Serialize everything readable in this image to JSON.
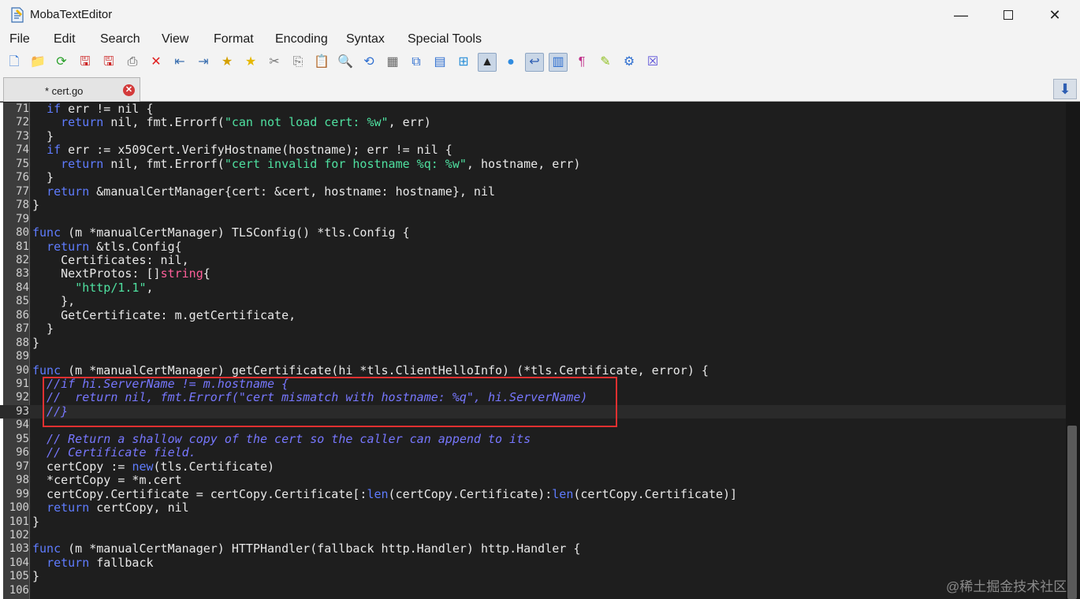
{
  "window": {
    "title": "MobaTextEditor"
  },
  "menu": [
    "File",
    "Edit",
    "Search",
    "View",
    "Format",
    "Encoding",
    "Syntax",
    "Special Tools"
  ],
  "toolbar": [
    {
      "name": "new-file-icon",
      "glyph": "🗋",
      "color": "#3a7bd5"
    },
    {
      "name": "open-folder-icon",
      "glyph": "📁",
      "color": "#e0a800"
    },
    {
      "name": "reload-icon",
      "glyph": "⟳",
      "color": "#2aa12a"
    },
    {
      "name": "save-icon",
      "glyph": "🖫",
      "color": "#cc2222"
    },
    {
      "name": "save-all-icon",
      "glyph": "🖫",
      "color": "#cc2222"
    },
    {
      "name": "print-icon",
      "glyph": "⎙",
      "color": "#555555"
    },
    {
      "name": "delete-icon",
      "glyph": "✕",
      "color": "#e02020"
    },
    {
      "name": "outdent-icon",
      "glyph": "⇤",
      "color": "#3a6fb0"
    },
    {
      "name": "indent-icon",
      "glyph": "⇥",
      "color": "#3a6fb0"
    },
    {
      "name": "bookmark-star-icon",
      "glyph": "★",
      "color": "#d4a000"
    },
    {
      "name": "bookmark-next-icon",
      "glyph": "★",
      "color": "#e6b800"
    },
    {
      "name": "cut-icon",
      "glyph": "✂",
      "color": "#777777"
    },
    {
      "name": "copy-icon",
      "glyph": "⎘",
      "color": "#777777"
    },
    {
      "name": "paste-icon",
      "glyph": "📋",
      "color": "#4a6fa5"
    },
    {
      "name": "find-icon",
      "glyph": "🔍",
      "color": "#2f6fd0"
    },
    {
      "name": "replace-icon",
      "glyph": "⟲",
      "color": "#2f6fd0"
    },
    {
      "name": "macro-icon",
      "glyph": "▦",
      "color": "#666666"
    },
    {
      "name": "compare-icon",
      "glyph": "⧉",
      "color": "#2f6fd0"
    },
    {
      "name": "split-view-icon",
      "glyph": "▤",
      "color": "#2f6fd0"
    },
    {
      "name": "windows-eol-icon",
      "glyph": "⊞",
      "color": "#2a8fd8"
    },
    {
      "name": "linux-eol-icon",
      "glyph": "▲",
      "color": "#222222"
    },
    {
      "name": "mac-eol-icon",
      "glyph": "●",
      "color": "#2f8be0"
    },
    {
      "name": "word-wrap-icon",
      "glyph": "↩",
      "color": "#2f5fb3"
    },
    {
      "name": "column-mode-icon",
      "glyph": "▥",
      "color": "#2f6fd0"
    },
    {
      "name": "pilcrow-icon",
      "glyph": "¶",
      "color": "#c0308a"
    },
    {
      "name": "highlight-icon",
      "glyph": "✎",
      "color": "#8fbf1f"
    },
    {
      "name": "settings-icon",
      "glyph": "⚙",
      "color": "#2f6fd0"
    },
    {
      "name": "close-doc-icon",
      "glyph": "☒",
      "color": "#5a4fd8"
    }
  ],
  "tabs": [
    {
      "label": "* cert.go"
    }
  ],
  "colors": {
    "keyword": "#5f7cff",
    "type": "#ff5f9a",
    "string": "#4fe0a0",
    "comment": "#7777ff",
    "text": "#e8e8e8"
  },
  "lines": [
    {
      "num": "71",
      "tokens": [
        [
          "  ",
          "t"
        ],
        [
          "if",
          "k"
        ],
        [
          " err != nil {",
          "t"
        ]
      ]
    },
    {
      "num": "72",
      "tokens": [
        [
          "    ",
          "t"
        ],
        [
          "return",
          "k"
        ],
        [
          " nil, fmt.Errorf(",
          "t"
        ],
        [
          "\"can not load cert: %w\"",
          "s"
        ],
        [
          ", err)",
          "t"
        ]
      ]
    },
    {
      "num": "73",
      "tokens": [
        [
          "  }",
          "t"
        ]
      ]
    },
    {
      "num": "74",
      "tokens": [
        [
          "  ",
          "t"
        ],
        [
          "if",
          "k"
        ],
        [
          " err := x509Cert.VerifyHostname(hostname); err != nil {",
          "t"
        ]
      ]
    },
    {
      "num": "75",
      "tokens": [
        [
          "    ",
          "t"
        ],
        [
          "return",
          "k"
        ],
        [
          " nil, fmt.Errorf(",
          "t"
        ],
        [
          "\"cert invalid for hostname %q: %w\"",
          "s"
        ],
        [
          ", hostname, err)",
          "t"
        ]
      ]
    },
    {
      "num": "76",
      "tokens": [
        [
          "  }",
          "t"
        ]
      ]
    },
    {
      "num": "77",
      "tokens": [
        [
          "  ",
          "t"
        ],
        [
          "return",
          "k"
        ],
        [
          " &manualCertManager{cert: &cert, hostname: hostname}, nil",
          "t"
        ]
      ]
    },
    {
      "num": "78",
      "tokens": [
        [
          "}",
          "t"
        ]
      ]
    },
    {
      "num": "79",
      "tokens": []
    },
    {
      "num": "80",
      "tokens": [
        [
          "func",
          "k"
        ],
        [
          " (m *manualCertManager) TLSConfig() *tls.Config {",
          "t"
        ]
      ]
    },
    {
      "num": "81",
      "tokens": [
        [
          "  ",
          "t"
        ],
        [
          "return",
          "k"
        ],
        [
          " &tls.Config{",
          "t"
        ]
      ]
    },
    {
      "num": "82",
      "tokens": [
        [
          "    Certificates: nil,",
          "t"
        ]
      ]
    },
    {
      "num": "83",
      "tokens": [
        [
          "    NextProtos: []",
          "t"
        ],
        [
          "string",
          "y"
        ],
        [
          "{",
          "t"
        ]
      ]
    },
    {
      "num": "84",
      "tokens": [
        [
          "      ",
          "t"
        ],
        [
          "\"http/1.1\"",
          "s"
        ],
        [
          ",",
          "t"
        ]
      ]
    },
    {
      "num": "85",
      "tokens": [
        [
          "    },",
          "t"
        ]
      ]
    },
    {
      "num": "86",
      "tokens": [
        [
          "    GetCertificate: m.getCertificate,",
          "t"
        ]
      ]
    },
    {
      "num": "87",
      "tokens": [
        [
          "  }",
          "t"
        ]
      ]
    },
    {
      "num": "88",
      "tokens": [
        [
          "}",
          "t"
        ]
      ]
    },
    {
      "num": "89",
      "tokens": []
    },
    {
      "num": "90",
      "tokens": [
        [
          "func",
          "k"
        ],
        [
          " (m *manualCertManager) getCertificate(hi *tls.ClientHelloInfo) (*tls.Certificate, error) {",
          "t"
        ]
      ]
    },
    {
      "num": "91",
      "tokens": [
        [
          "  //if hi.ServerName != m.hostname {",
          "c"
        ]
      ]
    },
    {
      "num": "92",
      "tokens": [
        [
          "  //  return nil, fmt.Errorf(\"cert mismatch with hostname: %q\", hi.ServerName)",
          "c"
        ]
      ]
    },
    {
      "num": "93",
      "tokens": [
        [
          "  //}",
          "c"
        ]
      ],
      "current": true
    },
    {
      "num": "94",
      "tokens": []
    },
    {
      "num": "95",
      "tokens": [
        [
          "  // Return a shallow copy of the cert so the caller can append to its",
          "c"
        ]
      ]
    },
    {
      "num": "96",
      "tokens": [
        [
          "  // Certificate field.",
          "c"
        ]
      ]
    },
    {
      "num": "97",
      "tokens": [
        [
          "  certCopy := ",
          "t"
        ],
        [
          "new",
          "k"
        ],
        [
          "(tls.Certificate)",
          "t"
        ]
      ]
    },
    {
      "num": "98",
      "tokens": [
        [
          "  *certCopy = *m.cert",
          "t"
        ]
      ]
    },
    {
      "num": "99",
      "tokens": [
        [
          "  certCopy.Certificate = certCopy.Certificate[:",
          "t"
        ],
        [
          "len",
          "k"
        ],
        [
          "(certCopy.Certificate):",
          "t"
        ],
        [
          "len",
          "k"
        ],
        [
          "(certCopy.Certificate)]",
          "t"
        ]
      ]
    },
    {
      "num": "100",
      "tokens": [
        [
          "  ",
          "t"
        ],
        [
          "return",
          "k"
        ],
        [
          " certCopy, nil",
          "t"
        ]
      ]
    },
    {
      "num": "101",
      "tokens": [
        [
          "}",
          "t"
        ]
      ]
    },
    {
      "num": "102",
      "tokens": []
    },
    {
      "num": "103",
      "tokens": [
        [
          "func",
          "k"
        ],
        [
          " (m *manualCertManager) HTTPHandler(fallback http.Handler) http.Handler {",
          "t"
        ]
      ]
    },
    {
      "num": "104",
      "tokens": [
        [
          "  ",
          "t"
        ],
        [
          "return",
          "k"
        ],
        [
          " fallback",
          "t"
        ]
      ]
    },
    {
      "num": "105",
      "tokens": [
        [
          "}",
          "t"
        ]
      ]
    },
    {
      "num": "106",
      "tokens": []
    }
  ],
  "watermark": "@稀土掘金技术社区"
}
